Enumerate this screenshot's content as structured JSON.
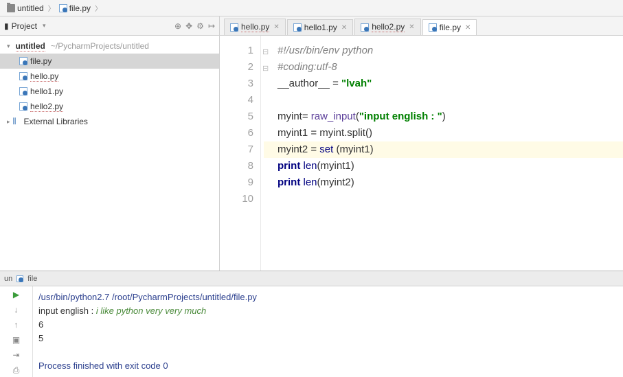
{
  "breadcrumb": [
    {
      "icon": "folder",
      "label": "untitled"
    },
    {
      "icon": "pyfile",
      "label": "file.py"
    }
  ],
  "sidebar": {
    "tool_title": "Project",
    "root": {
      "name": "untitled",
      "path": "~/PycharmProjects/untitled"
    },
    "files": [
      {
        "name": "file.py",
        "selected": true,
        "dotted": false
      },
      {
        "name": "hello.py",
        "selected": false,
        "dotted": true
      },
      {
        "name": "hello1.py",
        "selected": false,
        "dotted": false
      },
      {
        "name": "hello2.py",
        "selected": false,
        "dotted": true
      }
    ],
    "external": "External Libraries"
  },
  "tabs": [
    {
      "label": "hello.py",
      "active": false,
      "dotted": true
    },
    {
      "label": "hello1.py",
      "active": false,
      "dotted": false
    },
    {
      "label": "hello2.py",
      "active": false,
      "dotted": true
    },
    {
      "label": "file.py",
      "active": true,
      "dotted": false
    }
  ],
  "code": {
    "lines": [
      {
        "n": 1,
        "hl": false,
        "segs": [
          [
            "#!/usr/bin/env python",
            "c-cm"
          ]
        ]
      },
      {
        "n": 2,
        "hl": false,
        "segs": [
          [
            "#coding:utf-8",
            "c-cm"
          ]
        ]
      },
      {
        "n": 3,
        "hl": false,
        "segs": [
          [
            "__author__ = ",
            ""
          ],
          [
            "\"lvah\"",
            "c-str"
          ]
        ]
      },
      {
        "n": 4,
        "hl": false,
        "segs": [
          [
            "",
            ""
          ]
        ]
      },
      {
        "n": 5,
        "hl": false,
        "segs": [
          [
            "myint= ",
            ""
          ],
          [
            "raw_input",
            "c-fn"
          ],
          [
            "(",
            ""
          ],
          [
            "\"input english : \"",
            "c-str"
          ],
          [
            ")",
            ""
          ]
        ]
      },
      {
        "n": 6,
        "hl": false,
        "segs": [
          [
            "myint1 = myint.split()",
            ""
          ]
        ]
      },
      {
        "n": 7,
        "hl": true,
        "segs": [
          [
            "myint2 = ",
            ""
          ],
          [
            "set",
            "c-bi"
          ],
          [
            " (myint1)",
            ""
          ]
        ]
      },
      {
        "n": 8,
        "hl": false,
        "segs": [
          [
            "print",
            "c-kw"
          ],
          [
            " ",
            ""
          ],
          [
            "len",
            "c-bi"
          ],
          [
            "(myint1)",
            ""
          ]
        ]
      },
      {
        "n": 9,
        "hl": false,
        "segs": [
          [
            "print",
            "c-kw"
          ],
          [
            " ",
            ""
          ],
          [
            "len",
            "c-bi"
          ],
          [
            "(myint2)",
            ""
          ]
        ]
      },
      {
        "n": 10,
        "hl": false,
        "segs": [
          [
            "",
            ""
          ]
        ]
      }
    ]
  },
  "run": {
    "tab_label": "file",
    "tab_prefix": "un",
    "cmd": "/usr/bin/python2.7 /root/PycharmProjects/untitled/file.py",
    "prompt": "input english : ",
    "input": "i like python very very much",
    "out1": "6",
    "out2": "5",
    "exit": "Process finished with exit code 0"
  }
}
